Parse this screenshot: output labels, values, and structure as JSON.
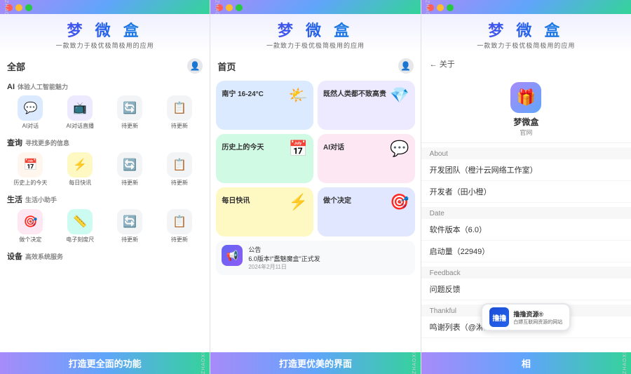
{
  "panels": [
    {
      "id": "panel1",
      "app_title": "梦 微 盒",
      "app_subtitle": "一款致力于极优极简极用的应用",
      "nav_title": "全部",
      "bottom_text": "打造更全面的功能",
      "sections": [
        {
          "label": "AI",
          "sub": "体验人工智能魅力",
          "items": [
            {
              "icon": "💬",
              "label": "AI对话",
              "bg": "bg-blue-light"
            },
            {
              "icon": "📺",
              "label": "AI对话直播",
              "bg": "bg-purple-light"
            },
            {
              "icon": "🔄",
              "label": "待更新",
              "bg": "bg-gray-light"
            },
            {
              "icon": "📋",
              "label": "待更新",
              "bg": "bg-gray-light"
            }
          ]
        },
        {
          "label": "查询",
          "sub": "寻找更多的信息",
          "items": [
            {
              "icon": "📅",
              "label": "历史上的今天",
              "bg": "bg-orange-light"
            },
            {
              "icon": "⚡",
              "label": "每日快讯",
              "bg": "bg-yellow-light"
            },
            {
              "icon": "🔄",
              "label": "待更新",
              "bg": "bg-gray-light"
            },
            {
              "icon": "📋",
              "label": "待更新",
              "bg": "bg-gray-light"
            }
          ]
        },
        {
          "label": "生活",
          "sub": "生活小助手",
          "items": [
            {
              "icon": "🎯",
              "label": "做个决定",
              "bg": "bg-pink-light"
            },
            {
              "icon": "📏",
              "label": "电子刻度尺",
              "bg": "bg-teal-light"
            },
            {
              "icon": "🔄",
              "label": "待更新",
              "bg": "bg-gray-light"
            },
            {
              "icon": "📋",
              "label": "待更新",
              "bg": "bg-gray-light"
            }
          ]
        },
        {
          "label": "设备",
          "sub": "高效系统服务"
        }
      ]
    },
    {
      "id": "panel2",
      "app_title": "梦 微 盒",
      "app_subtitle": "一款致力于极优极简极用的应用",
      "nav_title": "首页",
      "bottom_text": "打造更优美的界面",
      "cards": [
        {
          "title": "南宁 16-24°C",
          "sub": "",
          "icon": "🌤️",
          "bg": "#dbeafe"
        },
        {
          "title": "既然人类都不致高贵",
          "sub": "",
          "icon": "💎",
          "bg": "#ede9fe"
        },
        {
          "title": "历史上的今天",
          "sub": "",
          "icon": "📅",
          "bg": "#d1fae5"
        },
        {
          "title": "AI对话",
          "sub": "",
          "icon": "💬",
          "bg": "#fce7f3"
        },
        {
          "title": "每日快讯",
          "sub": "",
          "icon": "⚡",
          "bg": "#fef9c3"
        },
        {
          "title": "做个决定",
          "sub": "",
          "icon": "🎯",
          "bg": "#e0e7ff"
        }
      ],
      "announcement": {
        "label": "公告",
        "text": "6.0版本!\"蠢魅魔盒\"正式发",
        "date": "2024年2月11日"
      }
    },
    {
      "id": "panel3",
      "app_title": "梦 微 盒",
      "app_subtitle": "一款致力于极优极简极用的应用",
      "nav_title": "关于",
      "back_label": "← 关于",
      "bottom_text": "相",
      "app_info": {
        "name": "梦微盒",
        "tag": "官网"
      },
      "about_section_title": "About",
      "about_rows": [
        "开发团队（橙汁云网络工作室）",
        "开发者（田小橙）"
      ],
      "date_section_title": "Date",
      "date_rows": [
        "软件版本（6.0）",
        "启动量（22949）"
      ],
      "feedback_section_title": "Feedback",
      "feedback_rows": [
        "问题反馈"
      ],
      "thankful_section_title": "Thankful",
      "thankful_rows": [
        "鸣谢列表（@淋菇  @奶奶抱凌青橼）"
      ]
    }
  ],
  "watermark": {
    "side_text": "ZHAOXIN◇ZHAOXIN◇ZHAOXIN◇ZHAOXIN◇ZHAOXIN◇ZHAOXIN◇",
    "badge_logo": "撸",
    "badge_text": "撸撸资源®",
    "badge_sub": "白嫖互联网资源的网站"
  }
}
